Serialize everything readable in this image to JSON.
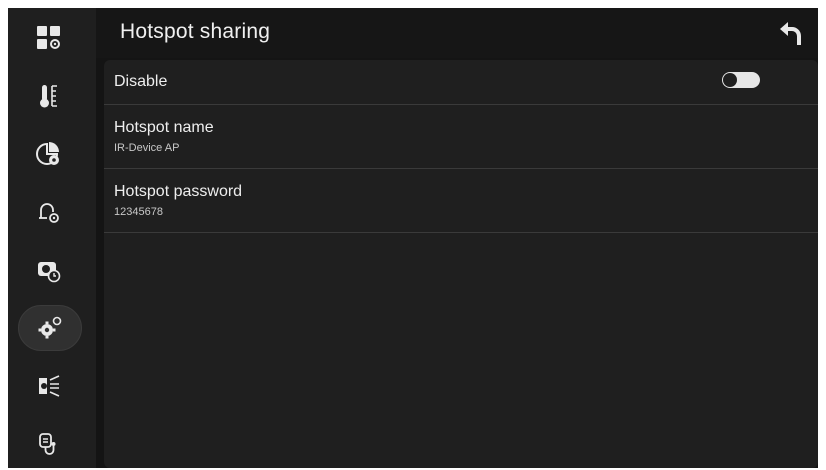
{
  "header": {
    "title": "Hotspot sharing",
    "back_icon": "back-arrow-icon"
  },
  "sidebar": {
    "items": [
      {
        "icon": "dashboard-settings-icon"
      },
      {
        "icon": "thermometer-icon"
      },
      {
        "icon": "pie-chart-settings-icon"
      },
      {
        "icon": "alarm-bell-settings-icon"
      },
      {
        "icon": "camera-timer-icon"
      },
      {
        "icon": "gear-settings-icon",
        "active": true
      },
      {
        "icon": "thermal-scan-icon"
      },
      {
        "icon": "medical-stethoscope-icon"
      }
    ]
  },
  "settings": {
    "disable": {
      "label": "Disable",
      "toggle_on": false
    },
    "hotspot_name": {
      "label": "Hotspot name",
      "value": "IR-Device AP"
    },
    "hotspot_password": {
      "label": "Hotspot password",
      "value": "12345678"
    }
  },
  "colors": {
    "background": "#141414",
    "panel": "#1f1f1f",
    "text": "#eeeeee",
    "accent": "#e6e6e6"
  }
}
